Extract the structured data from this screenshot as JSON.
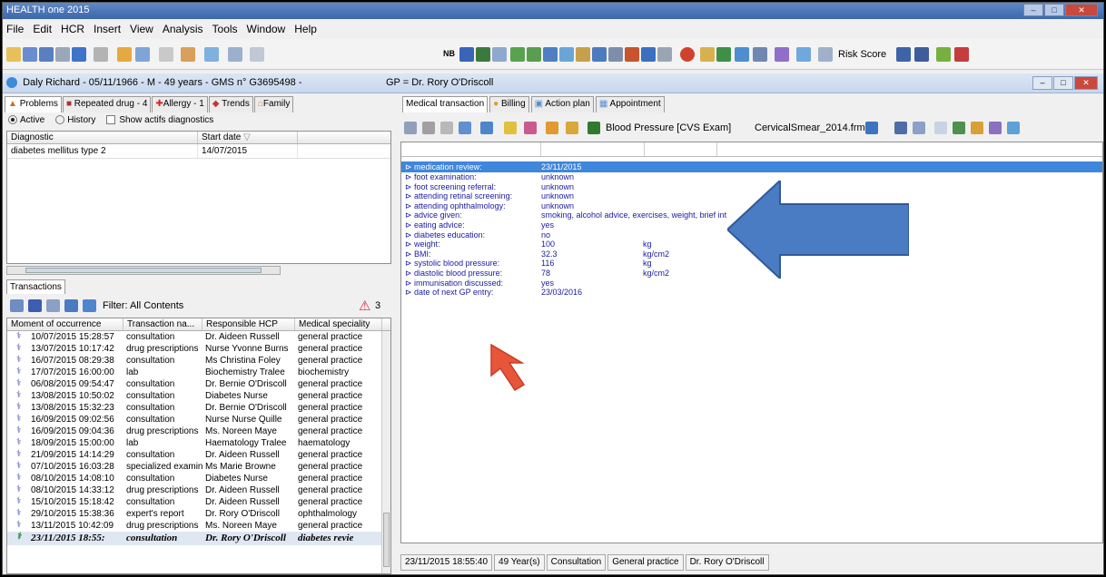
{
  "app_title": "HEALTH one 2015",
  "window_controls": [
    "–",
    "□",
    "✕"
  ],
  "menu": [
    "File",
    "Edit",
    "HCR",
    "Insert",
    "View",
    "Analysis",
    "Tools",
    "Window",
    "Help"
  ],
  "toolbar": {
    "nb_label": "NB",
    "risk_score": "Risk Score"
  },
  "patient_header": "Daly Richard - 05/11/1966 - M - 49 years - GMS n° G3695498 -",
  "gp_header": "GP = Dr. Rory O'Driscoll",
  "left_tabs": [
    "Problems",
    "Repeated drug - 4",
    "Allergy - 1",
    "Trends",
    "Family"
  ],
  "filter": {
    "active": "Active",
    "history": "History",
    "show_actifs": "Show actifs diagnostics"
  },
  "diagnostics": {
    "columns": [
      "Diagnostic",
      "Start date"
    ],
    "rows": [
      {
        "diagnostic": "diabetes mellitus type 2",
        "start": "14/07/2015"
      }
    ]
  },
  "transactions_tab": "Transactions",
  "transactions_filter": "Filter: All Contents",
  "alert_count": "3",
  "transactions": {
    "columns": [
      "Moment of occurrence",
      "Transaction na...",
      "Responsible HCP",
      "Medical speciality"
    ],
    "rows": [
      [
        "10/07/2015 15:28:57",
        "consultation",
        "Dr. Aideen Russell",
        "general practice"
      ],
      [
        "13/07/2015 10:17:42",
        "drug prescriptions",
        "Nurse Yvonne Burns",
        "general practice"
      ],
      [
        "16/07/2015 08:29:38",
        "consultation",
        "Ms Christina Foley",
        "general practice"
      ],
      [
        "17/07/2015 16:00:00",
        "lab",
        "Biochemistry Tralee",
        "biochemistry"
      ],
      [
        "06/08/2015 09:54:47",
        "consultation",
        "Dr. Bernie O'Driscoll",
        "general practice"
      ],
      [
        "13/08/2015 10:50:02",
        "consultation",
        "Diabetes Nurse",
        "general practice"
      ],
      [
        "13/08/2015 15:32:23",
        "consultation",
        "Dr. Bernie O'Driscoll",
        "general practice"
      ],
      [
        "16/09/2015 09:02:56",
        "consultation",
        "Nurse Nurse Quille",
        "general practice"
      ],
      [
        "16/09/2015 09:04:36",
        "drug prescriptions",
        "Ms. Noreen Maye",
        "general practice"
      ],
      [
        "18/09/2015 15:00:00",
        "lab",
        "Haematology Tralee",
        "haematology"
      ],
      [
        "21/09/2015 14:14:29",
        "consultation",
        "Dr. Aideen Russell",
        "general practice"
      ],
      [
        "07/10/2015 16:03:28",
        "specialized examin",
        "Ms Marie Browne",
        "general practice"
      ],
      [
        "08/10/2015 14:08:10",
        "consultation",
        "Diabetes Nurse",
        "general practice"
      ],
      [
        "08/10/2015 14:33:12",
        "drug prescriptions",
        "Dr. Aideen Russell",
        "general practice"
      ],
      [
        "15/10/2015 15:18:42",
        "consultation",
        "Dr. Aideen Russell",
        "general practice"
      ],
      [
        "29/10/2015 15:38:36",
        "expert's report",
        "Dr. Rory O'Driscoll",
        "ophthalmology"
      ],
      [
        "13/11/2015 10:42:09",
        "drug prescriptions",
        "Ms. Noreen Maye",
        "general practice"
      ]
    ],
    "last_row": [
      "23/11/2015 18:55:",
      "consultation",
      "Dr. Rory O'Driscoll",
      "diabetes revie"
    ]
  },
  "right_tabs": [
    "Medical transaction",
    "Billing",
    "Action plan",
    "Appointment"
  ],
  "right_toolbar": {
    "bp_label": "Blood Pressure [CVS Exam]",
    "form_label": "CervicalSmear_2014.frm"
  },
  "medical": [
    {
      "label": "medication review:",
      "value": "23/11/2015",
      "unit": "",
      "selected": true
    },
    {
      "label": "foot examination:",
      "value": "unknown",
      "unit": ""
    },
    {
      "label": "foot screening referral:",
      "value": "unknown",
      "unit": ""
    },
    {
      "label": "attending retinal screening:",
      "value": "unknown",
      "unit": ""
    },
    {
      "label": "attending ophthalmology:",
      "value": "unknown",
      "unit": ""
    },
    {
      "label": "advice given:",
      "value": "smoking, alcohol advice, exercises, weight, brief int",
      "unit": ""
    },
    {
      "label": "eating advice:",
      "value": "yes",
      "unit": ""
    },
    {
      "label": "diabetes education:",
      "value": "no",
      "unit": ""
    },
    {
      "label": "weight:",
      "value": "100",
      "unit": "kg"
    },
    {
      "label": "BMI:",
      "value": "32.3",
      "unit": "kg/cm2"
    },
    {
      "label": "systolic blood pressure:",
      "value": "116",
      "unit": "kg"
    },
    {
      "label": "diastolic blood pressure:",
      "value": "78",
      "unit": "kg/cm2"
    },
    {
      "label": "immunisation discussed:",
      "value": "yes",
      "unit": ""
    },
    {
      "label": "date of next GP entry:",
      "value": "23/03/2016",
      "unit": ""
    }
  ],
  "status_bar": [
    "23/11/2015 18:55:40",
    "49 Year(s)",
    "Consultation",
    "General practice",
    "Dr. Rory O'Driscoll"
  ],
  "colors": {
    "selection": "#3f86dd",
    "value_text": "#1a1aa0",
    "arrow_blue": "#4a7cc4",
    "arrow_red": "#e8563a"
  }
}
